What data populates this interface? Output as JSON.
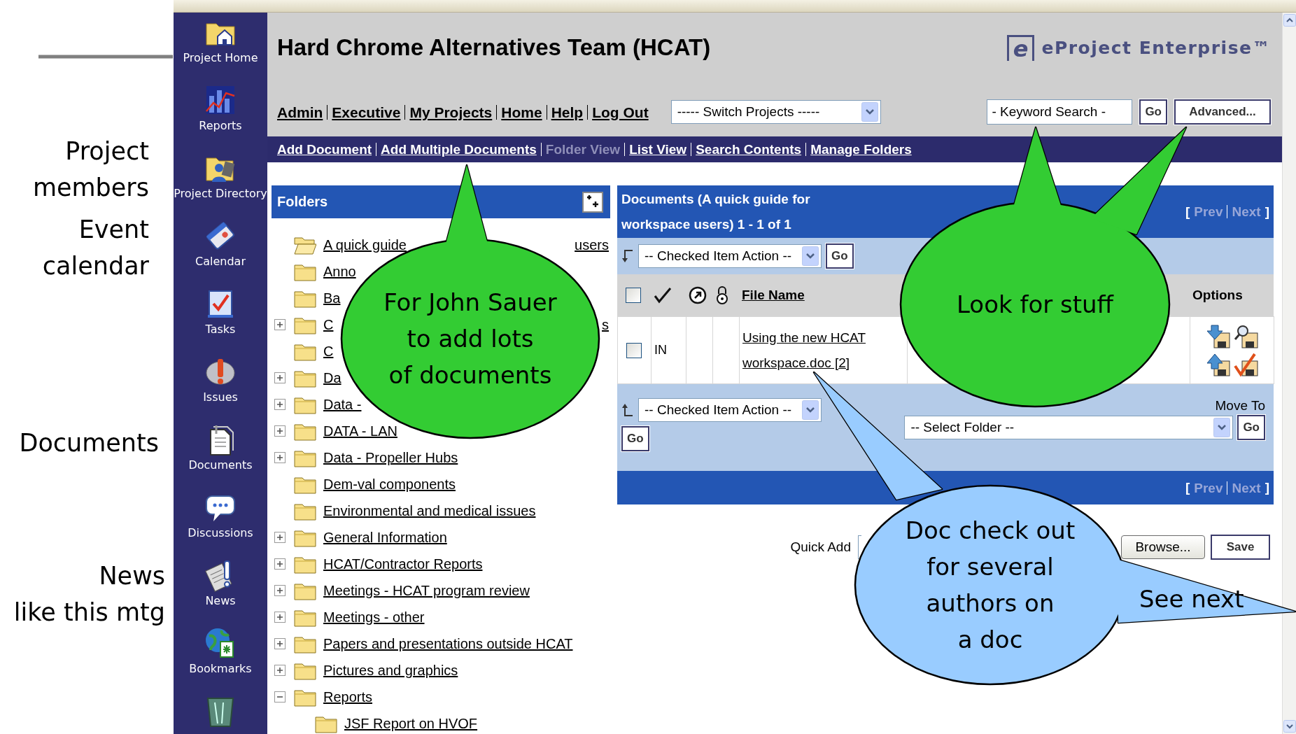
{
  "slide_labels": [
    "Project\nmembers",
    "Event\ncalendar",
    "Documents",
    "News\nlike this mtg"
  ],
  "sidebar": {
    "items": [
      {
        "label": "Project Home"
      },
      {
        "label": "Reports"
      },
      {
        "label": "Project Directory"
      },
      {
        "label": "Calendar"
      },
      {
        "label": "Tasks"
      },
      {
        "label": "Issues"
      },
      {
        "label": "Documents"
      },
      {
        "label": "Discussions"
      },
      {
        "label": "News"
      },
      {
        "label": "Bookmarks"
      }
    ]
  },
  "header": {
    "title": "Hard Chrome Alternatives Team (HCAT)",
    "logo_mark": "e",
    "logo": "eProject Enterprise™"
  },
  "top_links": [
    {
      "label": "Admin"
    },
    {
      "label": "Executive"
    },
    {
      "label": "My Projects"
    },
    {
      "label": "Home"
    },
    {
      "label": "Help"
    },
    {
      "label": "Log Out"
    }
  ],
  "project_switch": {
    "value": "----- Switch Projects -----"
  },
  "keyword_search": {
    "value": "- Keyword Search -",
    "go": "Go",
    "advanced": "Advanced..."
  },
  "doc_nav": [
    {
      "label": "Add Document",
      "selected": false
    },
    {
      "label": "Add Multiple Documents",
      "selected": false
    },
    {
      "label": "Folder View",
      "selected": true
    },
    {
      "label": "List View",
      "selected": false
    },
    {
      "label": "Search Contents",
      "selected": false
    },
    {
      "label": "Manage Folders",
      "selected": false
    }
  ],
  "folders": {
    "title": "Folders",
    "items": [
      {
        "label": "A quick guide",
        "tail": "users",
        "expandable": false,
        "selected": true
      },
      {
        "label": "Anno",
        "expandable": false,
        "selected": false
      },
      {
        "label": "Ba",
        "expandable": false,
        "selected": false
      },
      {
        "label": "C",
        "tail": "s",
        "expandable": true,
        "expanded": false,
        "selected": false
      },
      {
        "label": "C",
        "expandable": false,
        "selected": false
      },
      {
        "label": "Da",
        "expandable": true,
        "expanded": false,
        "selected": false
      },
      {
        "label": "Data -",
        "expandable": true,
        "expanded": false,
        "selected": false
      },
      {
        "label": "DATA - LAN",
        "expandable": true,
        "expanded": false,
        "selected": false
      },
      {
        "label": "Data - Propeller Hubs",
        "expandable": true,
        "expanded": false,
        "selected": false
      },
      {
        "label": "Dem-val components",
        "expandable": false,
        "selected": false
      },
      {
        "label": "Environmental and medical issues",
        "expandable": false,
        "selected": false
      },
      {
        "label": "General Information",
        "expandable": true,
        "expanded": false,
        "selected": false
      },
      {
        "label": "HCAT/Contractor Reports",
        "expandable": true,
        "expanded": false,
        "selected": false
      },
      {
        "label": "Meetings - HCAT program review",
        "expandable": true,
        "expanded": false,
        "selected": false
      },
      {
        "label": "Meetings - other",
        "expandable": true,
        "expanded": false,
        "selected": false
      },
      {
        "label": "Papers and presentations outside HCAT",
        "expandable": true,
        "expanded": false,
        "selected": false
      },
      {
        "label": "Pictures and graphics",
        "expandable": true,
        "expanded": false,
        "selected": false
      },
      {
        "label": "Reports",
        "expandable": true,
        "expanded": true,
        "selected": false,
        "children": [
          {
            "label": "JSF Report on HVOF",
            "expandable": false,
            "selected": false
          }
        ]
      }
    ]
  },
  "documents": {
    "title": "Documents (A quick guide for workspace users) 1 - 1 of 1",
    "pager_top": {
      "open": "[",
      "prev": "Prev",
      "prev_disabled": true,
      "next": "Next",
      "next_disabled": true,
      "close": "]"
    },
    "top_action": {
      "value": "-- Checked Item Action --",
      "go": "Go"
    },
    "columns": {
      "select_all_checked": false,
      "file_name": "File Name",
      "options": "Options"
    },
    "rows": [
      {
        "checked": false,
        "status": "IN",
        "file_name": "Using the new HCAT workspace.doc [2]"
      }
    ],
    "bottom_action": {
      "value": "-- Checked Item Action --",
      "go": "Go"
    },
    "move_to": {
      "label": "Move To",
      "value": "-- Select Folder --",
      "go": "Go"
    },
    "pager_bottom": {
      "open": "[",
      "prev": "Prev",
      "prev_disabled": true,
      "next": "Next",
      "next_disabled": true,
      "close": "]"
    }
  },
  "quick_add": {
    "label": "Quick Add",
    "browse": "Browse...",
    "save": "Save"
  },
  "callouts": [
    {
      "text": "For John Sauer\nto add lots\nof documents",
      "color": "#33cc33"
    },
    {
      "text": "Look for stuff",
      "color": "#33cc33"
    },
    {
      "text": "Doc check out\nfor several\nauthors on\na doc",
      "color": "#99ccff",
      "note": "See next"
    }
  ]
}
